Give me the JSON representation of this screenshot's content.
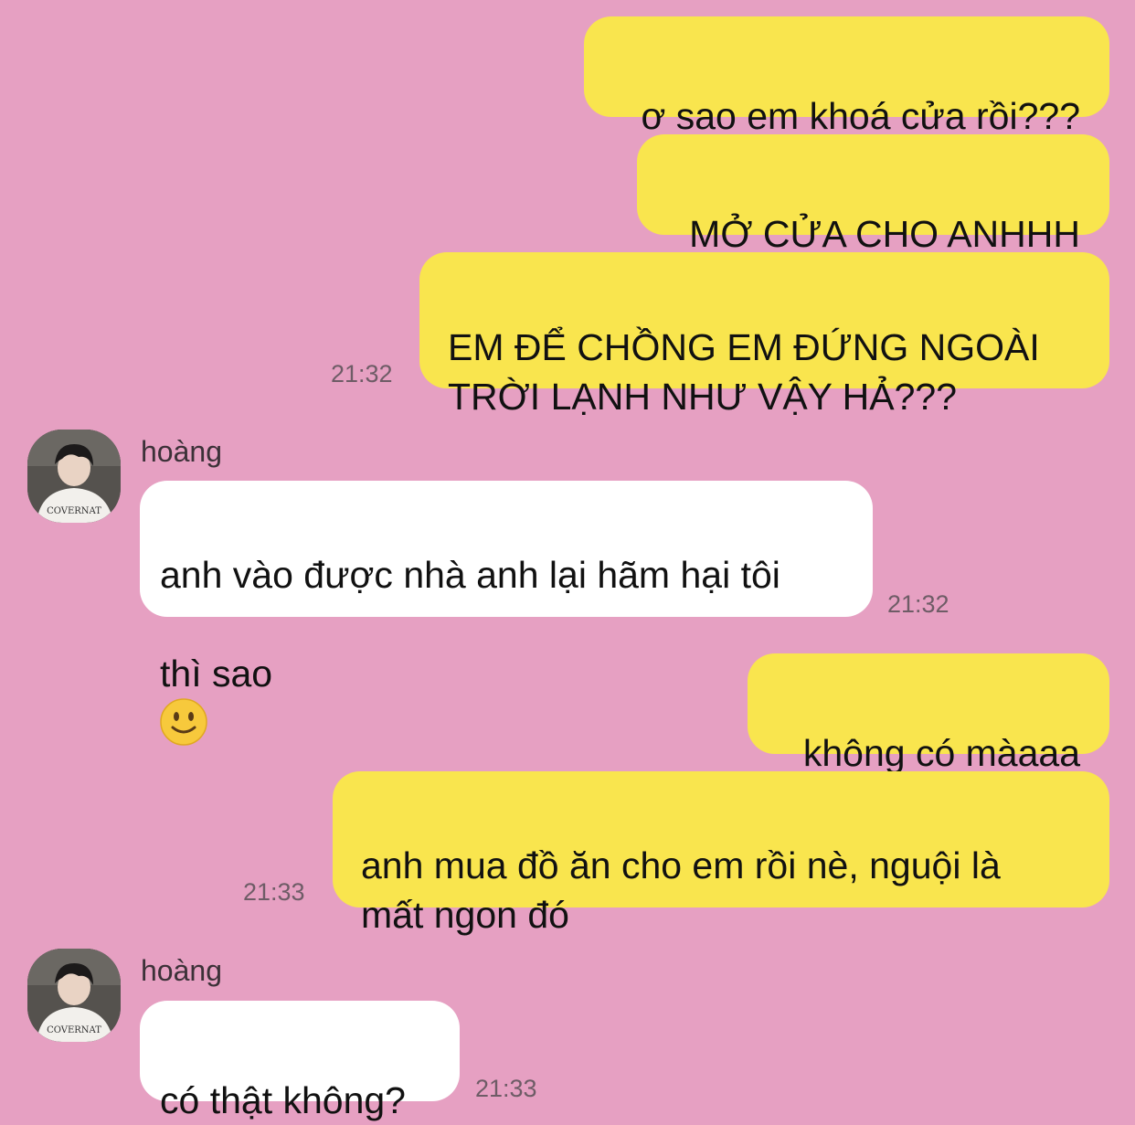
{
  "messages": [
    {
      "side": "me",
      "text": "ơ sao em khoá cửa rồi???"
    },
    {
      "side": "me",
      "text": "MỞ CỬA CHO ANHHH"
    },
    {
      "side": "me",
      "text": "EM ĐỂ CHỒNG EM ĐỨNG NGOÀI\nTRỜI LẠNH NHƯ VẬY HẢ???",
      "time": "21:32"
    },
    {
      "side": "other",
      "sender": "hoàng",
      "text_line1": "anh vào được nhà anh lại hãm hại tôi",
      "text_line2": "thì sao",
      "emoji": "slightly-smiling-face",
      "time": "21:32"
    },
    {
      "side": "me",
      "text": "không có màaaa"
    },
    {
      "side": "me",
      "text": "anh mua đồ ăn cho em rồi nè, nguội là\nmất ngon đó",
      "time": "21:33"
    },
    {
      "side": "other",
      "sender": "hoàng",
      "text": "có thật không?",
      "time": "21:33"
    }
  ],
  "avatar": {
    "shirt_text": "COVERNAT"
  },
  "colors": {
    "background": "#e6a0c2",
    "my_bubble": "#f9e54e",
    "their_bubble": "#ffffff",
    "time_text": "#6e5c66"
  }
}
